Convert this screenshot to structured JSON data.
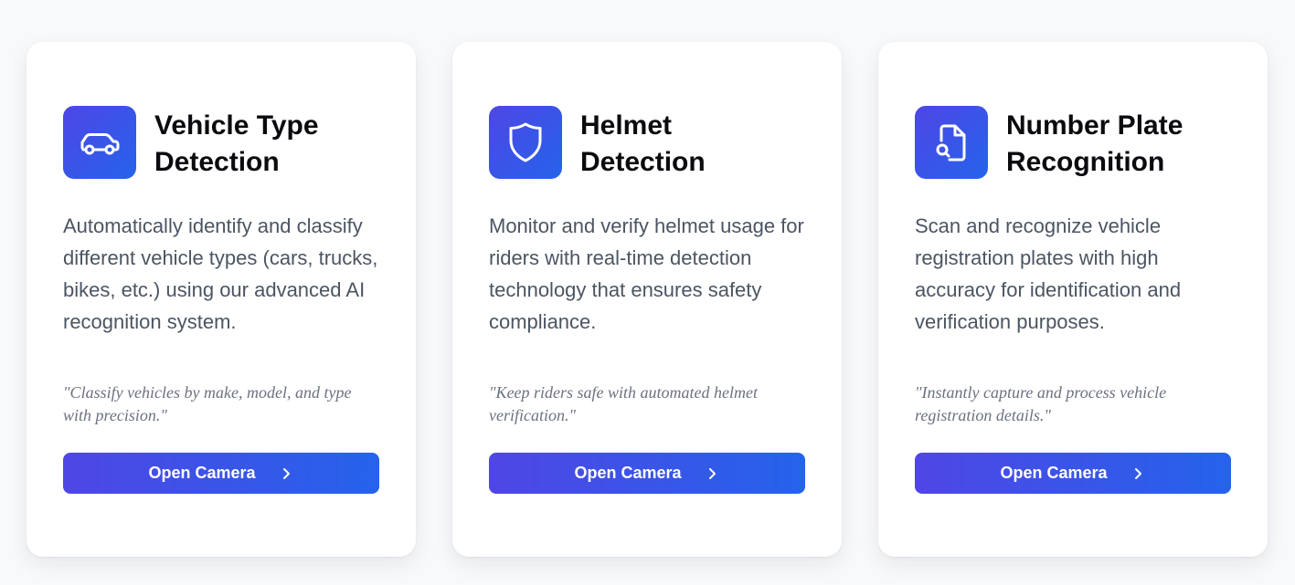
{
  "cards": [
    {
      "icon": "car-icon",
      "title_line1": "Vehicle Type",
      "title_line2": "Detection",
      "description": "Automatically identify and classify different vehicle types (cars, trucks, bikes, etc.) using our advanced AI recognition system.",
      "quote": "\"Classify vehicles by make, model, and type with precision.\"",
      "button_label": "Open Camera"
    },
    {
      "icon": "shield-icon",
      "title_line1": "Helmet",
      "title_line2": "Detection",
      "description": "Monitor and verify helmet usage for riders with real-time detection technology that ensures safety compliance.",
      "quote": "\"Keep riders safe with automated helmet verification.\"",
      "button_label": "Open Camera"
    },
    {
      "icon": "document-search-icon",
      "title_line1": "Number Plate",
      "title_line2": "Recognition",
      "description": "Scan and recognize vehicle registration plates with high accuracy for identification and verification purposes.",
      "quote": "\"Instantly capture and process vehicle registration details.\"",
      "button_label": "Open Camera"
    }
  ],
  "colors": {
    "accent_start": "#4f46e5",
    "accent_end": "#2563eb"
  }
}
